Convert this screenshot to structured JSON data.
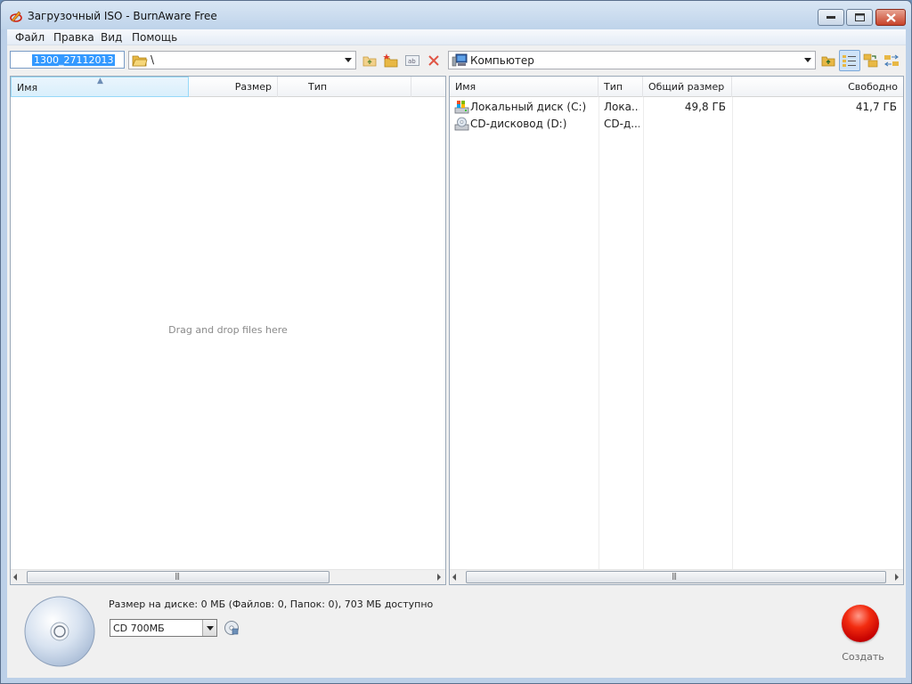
{
  "window": {
    "title": "Загрузочный ISO - BurnAware Free",
    "min_glyph": "▬",
    "max_glyph": "▢",
    "close_glyph": "✕"
  },
  "menu": [
    "Файл",
    "Правка",
    "Вид",
    "Помощь"
  ],
  "toolbar": {
    "disc_label": "1300_27112013",
    "current_path": "\\",
    "location": "Компьютер"
  },
  "compilation_pane": {
    "columns": [
      "Имя",
      "Размер",
      "Тип",
      ""
    ],
    "empty_hint": "Drag and drop files here"
  },
  "browser_pane": {
    "columns": [
      "Имя",
      "Тип",
      "Общий размер",
      "Свободно"
    ],
    "rows": [
      {
        "name": "Локальный диск (C:)",
        "type": "Лока...",
        "total": "49,8 ГБ",
        "free": "41,7 ГБ",
        "icon": "hard-drive-icon"
      },
      {
        "name": "CD-дисковод (D:)",
        "type": "CD-д...",
        "total": "",
        "free": "",
        "icon": "cd-drive-icon"
      }
    ]
  },
  "bottom": {
    "disc_info": "Размер на диске: 0 МБ (Файлов: 0, Папок: 0), 703 МБ доступно",
    "disc_type": "CD 700МБ",
    "burn_label": "Создать"
  },
  "colors": {
    "burn": "#e01a0a",
    "selection": "#3399ff",
    "sorted_header": "#d9effc"
  }
}
